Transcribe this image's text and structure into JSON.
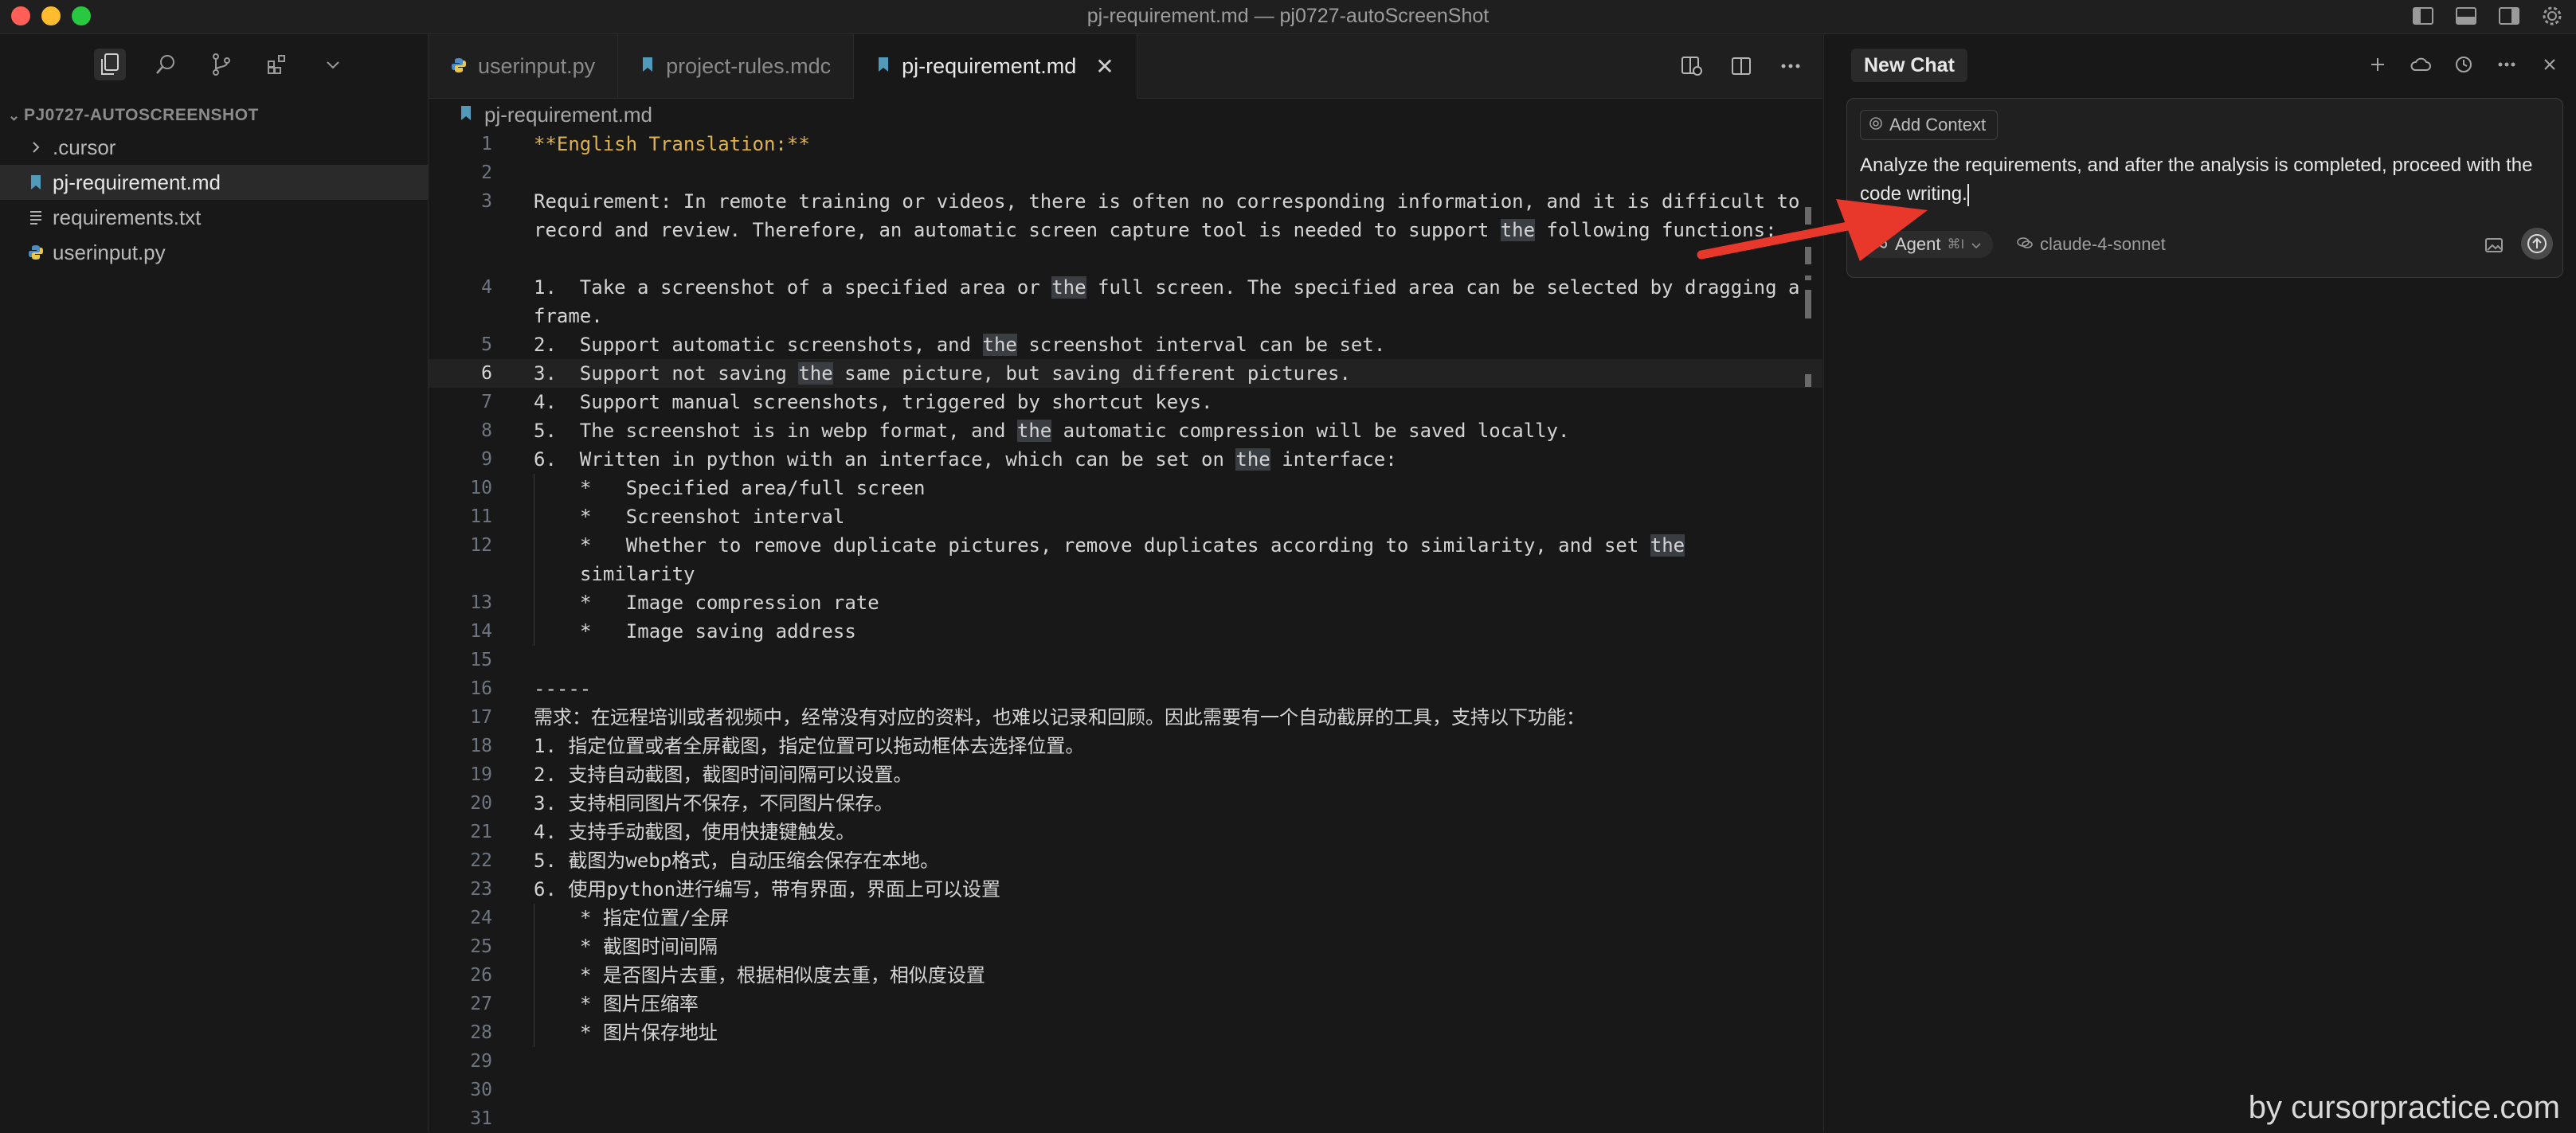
{
  "window": {
    "title": "pj-requirement.md — pj0727-autoScreenShot"
  },
  "sidebar": {
    "explorer_title": "PJ0727-AUTOSCREENSHOT",
    "items": [
      {
        "label": ".cursor",
        "icon": "chevron-right-icon",
        "selected": false
      },
      {
        "label": "pj-requirement.md",
        "icon": "markdown-file-icon",
        "selected": true
      },
      {
        "label": "requirements.txt",
        "icon": "text-file-icon",
        "selected": false
      },
      {
        "label": "userinput.py",
        "icon": "python-file-icon",
        "selected": false
      }
    ]
  },
  "tabs": [
    {
      "label": "userinput.py",
      "icon": "python-file-icon",
      "active": false
    },
    {
      "label": "project-rules.mdc",
      "icon": "markdown-file-icon",
      "active": false
    },
    {
      "label": "pj-requirement.md",
      "icon": "markdown-file-icon",
      "active": true
    }
  ],
  "breadcrumb": "pj-requirement.md",
  "code": {
    "current_line": 6,
    "lines": [
      {
        "n": "1",
        "text": "**English Translation:**"
      },
      {
        "n": "2",
        "text": ""
      },
      {
        "n": "3",
        "text": "Requirement: In remote training or videos, there is often no corresponding information, and it is difficult to record and review. Therefore, an automatic screen capture tool is needed to support the following functions:"
      },
      {
        "n": "4",
        "text": "1.  Take a screenshot of a specified area or the full screen. The specified area can be selected by dragging a frame."
      },
      {
        "n": "5",
        "text": "2.  Support automatic screenshots, and the screenshot interval can be set."
      },
      {
        "n": "6",
        "text": "3.  Support not saving the same picture, but saving different pictures."
      },
      {
        "n": "7",
        "text": "4.  Support manual screenshots, triggered by shortcut keys."
      },
      {
        "n": "8",
        "text": "5.  The screenshot is in webp format, and the automatic compression will be saved locally."
      },
      {
        "n": "9",
        "text": "6.  Written in python with an interface, which can be set on the interface:"
      },
      {
        "n": "10",
        "text": "*   Specified area/full screen"
      },
      {
        "n": "11",
        "text": "*   Screenshot interval"
      },
      {
        "n": "12",
        "text": "*   Whether to remove duplicate pictures, remove duplicates according to similarity, and set the similarity"
      },
      {
        "n": "13",
        "text": "*   Image compression rate"
      },
      {
        "n": "14",
        "text": "*   Image saving address"
      },
      {
        "n": "15",
        "text": ""
      },
      {
        "n": "16",
        "text": "-----"
      },
      {
        "n": "17",
        "text": "需求：在远程培训或者视频中，经常没有对应的资料，也难以记录和回顾。因此需要有一个自动截屏的工具，支持以下功能："
      },
      {
        "n": "18",
        "text": "1. 指定位置或者全屏截图，指定位置可以拖动框体去选择位置。"
      },
      {
        "n": "19",
        "text": "2. 支持自动截图，截图时间间隔可以设置。"
      },
      {
        "n": "20",
        "text": "3. 支持相同图片不保存，不同图片保存。"
      },
      {
        "n": "21",
        "text": "4. 支持手动截图，使用快捷键触发。"
      },
      {
        "n": "22",
        "text": "5. 截图为webp格式，自动压缩会保存在本地。"
      },
      {
        "n": "23",
        "text": "6. 使用python进行编写，带有界面，界面上可以设置"
      },
      {
        "n": "24",
        "text": "* 指定位置/全屏"
      },
      {
        "n": "25",
        "text": "* 截图时间间隔"
      },
      {
        "n": "26",
        "text": "* 是否图片去重，根据相似度去重，相似度设置"
      },
      {
        "n": "27",
        "text": "* 图片压缩率"
      },
      {
        "n": "28",
        "text": "* 图片保存地址"
      },
      {
        "n": "29",
        "text": ""
      },
      {
        "n": "30",
        "text": ""
      },
      {
        "n": "31",
        "text": ""
      }
    ]
  },
  "chat": {
    "tab_label": "New Chat",
    "add_context_label": "Add Context",
    "prompt_text": "Analyze the requirements, and after the analysis is completed, proceed with the code writing.",
    "mode_label": "Agent",
    "mode_shortcut": "⌘I",
    "model_label": "claude-4-sonnet"
  },
  "watermark": "by cursorpractice.com",
  "colors": {
    "background": "#181818",
    "heading_yellow": "#e0b24c",
    "annotation_arrow": "#e8382c"
  }
}
